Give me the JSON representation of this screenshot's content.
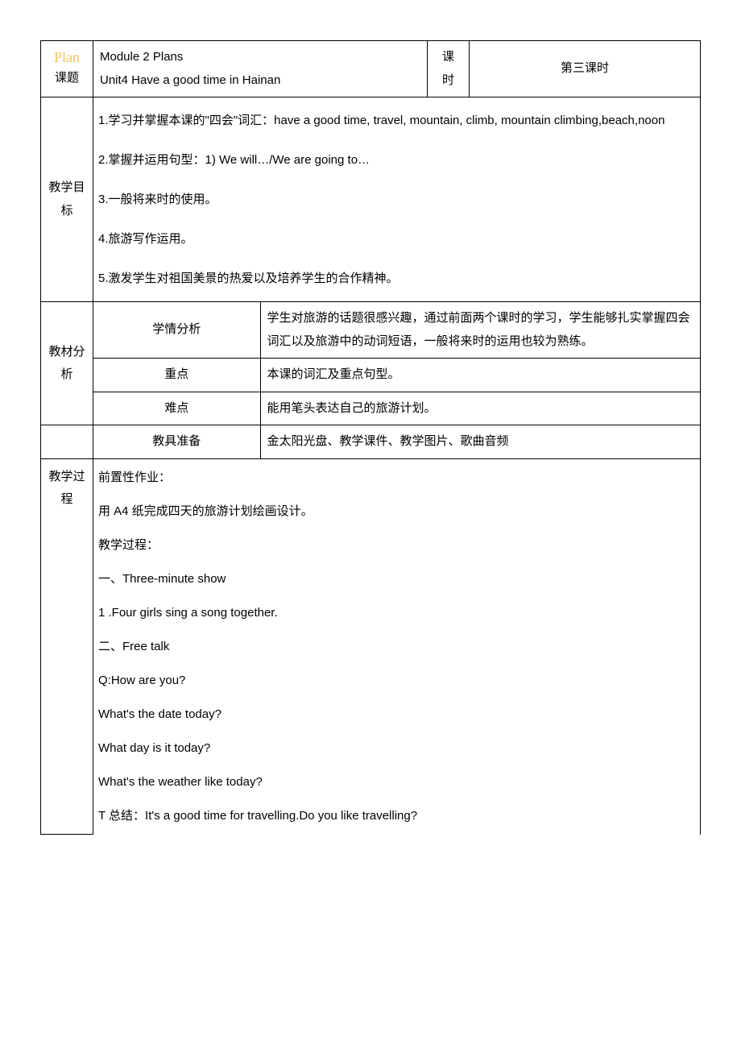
{
  "header": {
    "watermark": "Plan",
    "topic_label": "课题",
    "module_line": "Module 2 Plans",
    "unit_line": "Unit4 Have a good time in Hainan",
    "period_label_1": "课",
    "period_label_2": "时",
    "period_value": "第三课时"
  },
  "goals": {
    "label": "教学目标",
    "items": [
      "1.学习并掌握本课的\"四会\"词汇：have a good time, travel, mountain, climb, mountain climbing,beach,noon",
      "2.掌握并运用句型：1) We will…/We are going to…",
      "3.一般将来时的使用。",
      "4.旅游写作运用。",
      "5.激发学生对祖国美景的热爱以及培养学生的合作精神。"
    ]
  },
  "analysis": {
    "label": "教材分析",
    "rows": [
      {
        "sub": "学情分析",
        "text": "学生对旅游的话题很感兴趣，通过前面两个课时的学习，学生能够扎实掌握四会词汇以及旅游中的动词短语，一般将来时的运用也较为熟练。"
      },
      {
        "sub": "重点",
        "text": "本课的词汇及重点句型。"
      },
      {
        "sub": "难点",
        "text": "能用笔头表达自己的旅游计划。"
      }
    ],
    "tools": {
      "sub": "教具准备",
      "text": "金太阳光盘、教学课件、教学图片、歌曲音频"
    }
  },
  "process": {
    "label": "教学过程",
    "lines": [
      {
        "text": "前置性作业：",
        "indent": false
      },
      {
        "text": "用 A4 纸完成四天的旅游计划绘画设计。",
        "indent": false
      },
      {
        "text": "教学过程：",
        "indent": false
      },
      {
        "text": "一、Three-minute show",
        "indent": false
      },
      {
        "text": "1 .Four girls sing a song together.",
        "indent": false
      },
      {
        "text": "二、Free talk",
        "indent": false
      },
      {
        "text": "Q:How are you?",
        "indent": false
      },
      {
        "text": "What's the date today?",
        "indent": true
      },
      {
        "text": "What day is it today?",
        "indent": true
      },
      {
        "text": "What's the weather like today?",
        "indent": true
      },
      {
        "text": "T 总结：It's a good time for travelling.Do you like travelling?",
        "indent": false
      }
    ]
  }
}
